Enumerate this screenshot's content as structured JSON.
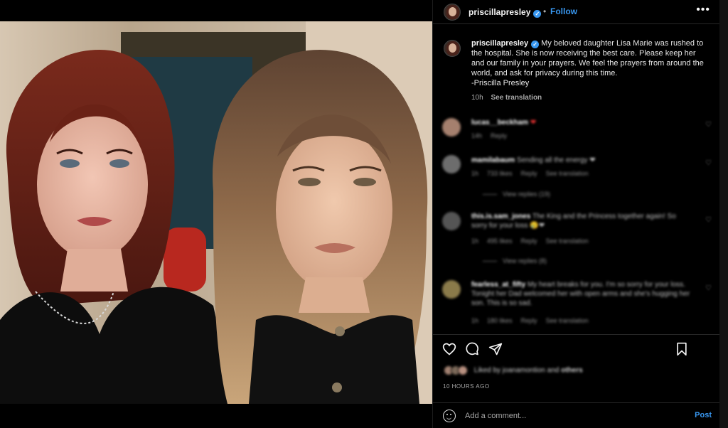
{
  "header": {
    "username": "priscillapresley",
    "verified": "verified-badge",
    "separator": "•",
    "follow_label": "Follow",
    "more_label": "•••"
  },
  "caption": {
    "username": "priscillapresley",
    "text": "My beloved daughter Lisa Marie was rushed to the hospital. She is now receiving the best care. Please keep her and our family in your prayers. We feel the prayers from around the world, and ask for privacy during this time.",
    "signature": "-Priscilla Presley",
    "time": "10h",
    "translate_label": "See translation"
  },
  "comments": [
    {
      "username": "lucas__beckham",
      "text": "❤",
      "meta": [
        "14h",
        "Reply"
      ],
      "replies": ""
    },
    {
      "username": "mamilabaum",
      "text": "Sending all the energy ❤",
      "meta": [
        "1h",
        "733 likes",
        "Reply",
        "See translation"
      ],
      "replies": "View replies (19)"
    },
    {
      "username": "this.is.sam_jones",
      "text": "The King and the Princess together again! So sorry for your loss 😢❤",
      "meta": [
        "1h",
        "495 likes",
        "Reply",
        "See translation"
      ],
      "replies": "View replies (8)"
    },
    {
      "username": "fearless_at_fifty",
      "text": "My heart breaks for you. I'm so sorry for your loss. Tonight her Dad welcomed her with open arms and she's hugging her son. This is so sad.",
      "meta": [
        "1h",
        "180 likes",
        "Reply",
        "See translation"
      ],
      "replies": ""
    }
  ],
  "likes": {
    "text": "Liked by joanamontion",
    "and": "and",
    "others": "others"
  },
  "timestamp": "10 HOURS AGO",
  "add_comment": {
    "placeholder": "Add a comment...",
    "post_label": "Post"
  },
  "colors": {
    "background": "#000000",
    "accent": "#3897f0",
    "text": "#f5f5f5",
    "muted": "#a8a8a8"
  }
}
